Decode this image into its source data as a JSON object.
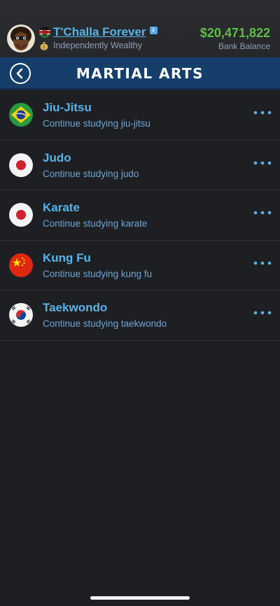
{
  "header": {
    "name": "T'Challa Forever",
    "status": "Independently Wealthy",
    "balance": "$20,471,822",
    "balance_label": "Bank Balance"
  },
  "titlebar": {
    "title": "MARTIAL ARTS"
  },
  "items": [
    {
      "title": "Jiu-Jitsu",
      "subtitle": "Continue studying jiu-jitsu",
      "flag": "brazil-flag"
    },
    {
      "title": "Judo",
      "subtitle": "Continue studying judo",
      "flag": "japan-flag"
    },
    {
      "title": "Karate",
      "subtitle": "Continue studying karate",
      "flag": "japan-flag"
    },
    {
      "title": "Kung Fu",
      "subtitle": "Continue studying kung fu",
      "flag": "china-flag"
    },
    {
      "title": "Taekwondo",
      "subtitle": "Continue studying taekwondo",
      "flag": "south-korea-flag"
    }
  ],
  "colors": {
    "accent": "#58b4e8",
    "money": "#5ebd46",
    "titlebar": "#163e6a",
    "background": "#1e1f22"
  }
}
